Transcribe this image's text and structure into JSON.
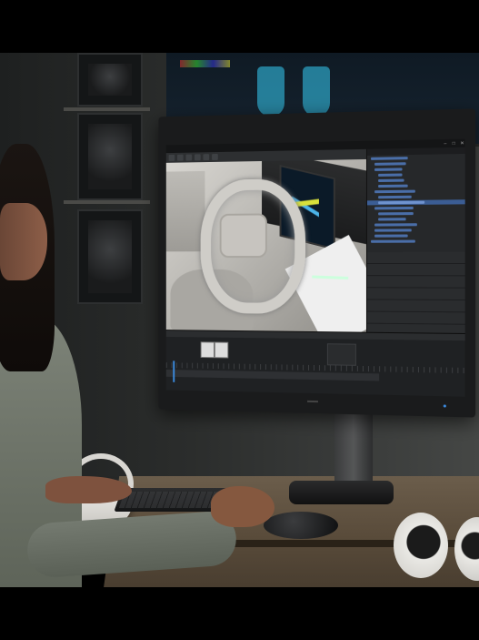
{
  "app": {
    "window_controls": [
      "–",
      "□",
      "✕"
    ]
  },
  "timeline": {
    "tabs": [
      "",
      "",
      "",
      "",
      ""
    ]
  },
  "colors": {
    "accent": "#3b8be0",
    "selection": "#3b5d94",
    "timeline_marker": "#4caf50",
    "ui_dark": "#232527"
  },
  "icons": [
    "vr-headset-icon",
    "vr-controller-icon"
  ]
}
